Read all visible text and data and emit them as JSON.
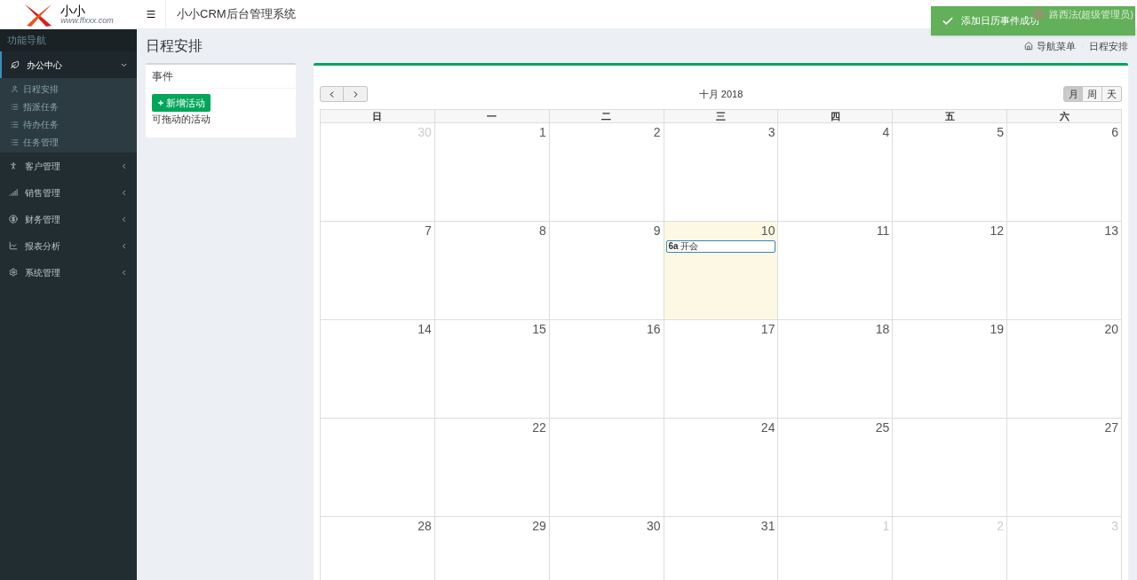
{
  "logo": {
    "name": "小小",
    "url": "www.ffxxx.com"
  },
  "header": {
    "title": "小小CRM后台管理系统",
    "user": "路西法(超级管理员)"
  },
  "toast": {
    "message": "添加日历事件成功"
  },
  "sidebar": {
    "heading": "功能导航",
    "items": [
      {
        "label": "办公中心",
        "expanded": true,
        "children": [
          {
            "label": "日程安排"
          },
          {
            "label": "指派任务"
          },
          {
            "label": "待办任务"
          },
          {
            "label": "任务管理"
          }
        ]
      },
      {
        "label": "客户管理",
        "expanded": false
      },
      {
        "label": "销售管理",
        "expanded": false
      },
      {
        "label": "财务管理",
        "expanded": false
      },
      {
        "label": "报表分析",
        "expanded": false
      },
      {
        "label": "系统管理",
        "expanded": false
      }
    ]
  },
  "page": {
    "title": "日程安排",
    "breadcrumb": [
      "导航菜单",
      "日程安排"
    ]
  },
  "events_panel": {
    "title": "事件",
    "add_button": "新增活动",
    "hint": "可拖动的活动"
  },
  "calendar": {
    "title": "十月 2018",
    "views": [
      {
        "label": "月",
        "selected": true
      },
      {
        "label": "周",
        "selected": false
      },
      {
        "label": "天",
        "selected": false
      }
    ],
    "weekdays": [
      "日",
      "一",
      "二",
      "三",
      "四",
      "五",
      "六"
    ],
    "weeks": [
      [
        {
          "date": "30",
          "other_month": true
        },
        {
          "date": "1",
          "other_month": false
        },
        {
          "date": "2",
          "other_month": false
        },
        {
          "date": "3",
          "other_month": false
        },
        {
          "date": "4",
          "other_month": false
        },
        {
          "date": "5",
          "other_month": false
        },
        {
          "date": "6",
          "other_month": false
        }
      ],
      [
        {
          "date": "7",
          "other_month": false
        },
        {
          "date": "8",
          "other_month": false
        },
        {
          "date": "9",
          "other_month": false
        },
        {
          "date": "10",
          "other_month": false,
          "today": true,
          "events": [
            {
              "time": "6a",
              "title": "开会"
            }
          ]
        },
        {
          "date": "11",
          "other_month": false
        },
        {
          "date": "12",
          "other_month": false
        },
        {
          "date": "13",
          "other_month": false
        }
      ],
      [
        {
          "date": "14",
          "other_month": false
        },
        {
          "date": "15",
          "other_month": false
        },
        {
          "date": "16",
          "other_month": false
        },
        {
          "date": "17",
          "other_month": false
        },
        {
          "date": "18",
          "other_month": false
        },
        {
          "date": "19",
          "other_month": false
        },
        {
          "date": "20",
          "other_month": false
        }
      ],
      [
        {
          "kind": "blank"
        },
        {
          "kind": "day",
          "date": "22",
          "other_month": false
        },
        {
          "kind": "blank"
        },
        {
          "kind": "day",
          "date": "24",
          "other_month": false
        },
        {
          "kind": "day",
          "date": "25",
          "other_month": false
        },
        {
          "kind": "blank"
        },
        {
          "kind": "day",
          "date": "27",
          "other_month": false
        }
      ],
      [
        {
          "date": "28",
          "other_month": false
        },
        {
          "date": "29",
          "other_month": false
        },
        {
          "date": "30",
          "other_month": false
        },
        {
          "date": "31",
          "other_month": false
        },
        {
          "date": "1",
          "other_month": true
        },
        {
          "date": "2",
          "other_month": true
        },
        {
          "date": "3",
          "other_month": true
        }
      ]
    ]
  }
}
